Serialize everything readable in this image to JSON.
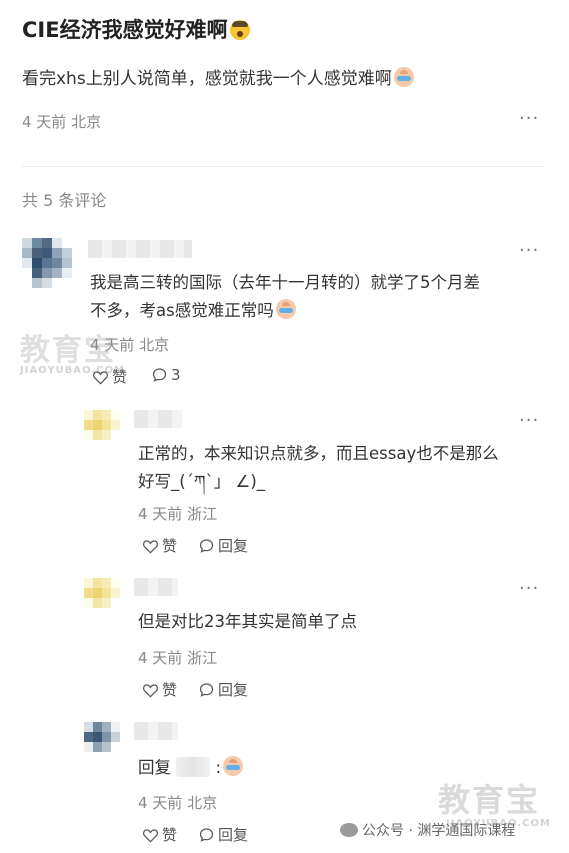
{
  "post": {
    "title": "CIE经济我感觉好难啊",
    "title_emoji": "shocked-face-emoji",
    "body": "看完xhs上别人说简单，感觉就我一个人感觉难啊",
    "body_emoji": "crying-face-emoji",
    "meta": "4 天前 北京",
    "more": "···"
  },
  "comments_header": {
    "count_label": "共 5 条评论"
  },
  "comments": [
    {
      "line1": "我是高三转的国际（去年十一月转的）就学了5个月差",
      "line2": "不多，考as感觉难正常吗",
      "meta": "4 天前 北京",
      "like_label": "赞",
      "reply_count": "3"
    }
  ],
  "replies": [
    {
      "line1": "正常的，本来知识点就多，而且essay也不是那么",
      "line2": "好写_(´ཀ`」 ∠)_",
      "meta": "4 天前 浙江",
      "like_label": "赞",
      "reply_label": "回复"
    },
    {
      "line1": "但是对比23年其实是简单了点",
      "meta": "4 天前 浙江",
      "like_label": "赞",
      "reply_label": "回复"
    },
    {
      "prefix": "回复",
      "suffix": ":",
      "meta": "4 天前 北京",
      "like_label": "赞",
      "reply_label": "回复"
    }
  ],
  "watermark": {
    "main": "教育宝",
    "sub": "JIAOYUBAO.COM"
  },
  "footer": {
    "source": "公众号 · 渊学通国际课程"
  },
  "colors": {
    "text": "#333333",
    "muted": "#888888",
    "divider": "#ececec"
  }
}
